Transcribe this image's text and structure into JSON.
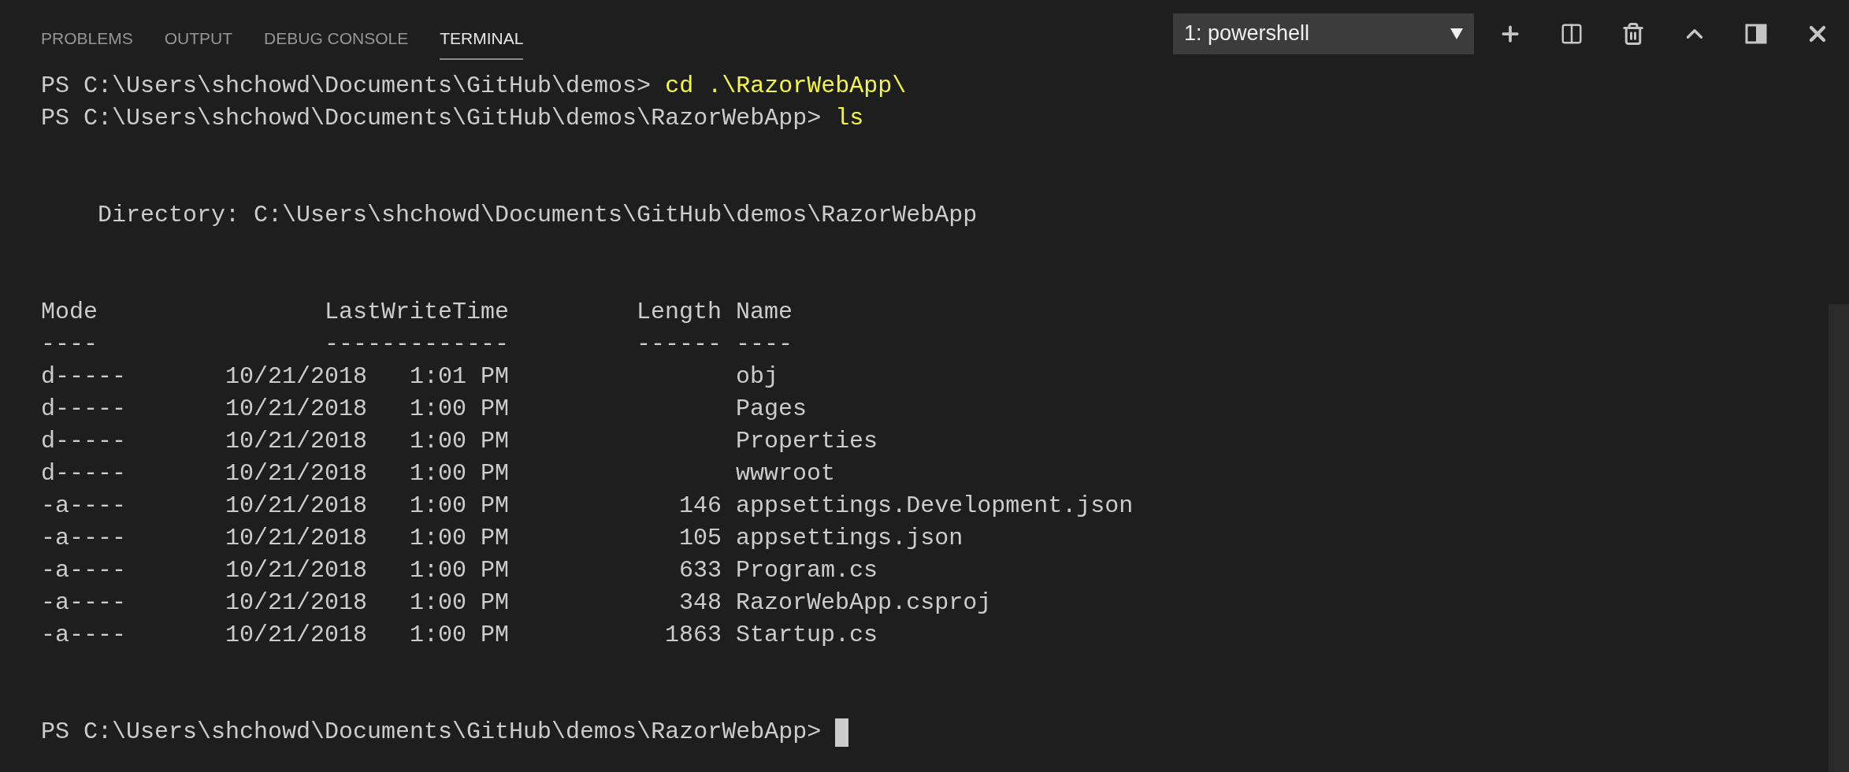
{
  "tabs": [
    {
      "label": "PROBLEMS",
      "selected": false
    },
    {
      "label": "OUTPUT",
      "selected": false
    },
    {
      "label": "DEBUG CONSOLE",
      "selected": false
    },
    {
      "label": "TERMINAL",
      "selected": true
    }
  ],
  "terminal_select": {
    "value": "1: powershell"
  },
  "commands": [
    {
      "prompt": "PS C:\\Users\\shchowd\\Documents\\GitHub\\demos>",
      "command": "cd .\\RazorWebApp\\"
    },
    {
      "prompt": "PS C:\\Users\\shchowd\\Documents\\GitHub\\demos\\RazorWebApp>",
      "command": "ls"
    }
  ],
  "directory_line": "Directory: C:\\Users\\shchowd\\Documents\\GitHub\\demos\\RazorWebApp",
  "listing": {
    "columns": [
      "Mode",
      "LastWriteTime",
      "Length",
      "Name"
    ],
    "separators": [
      "----",
      "-------------",
      "------",
      "----"
    ],
    "rows": [
      {
        "mode": "d-----",
        "date": "10/21/2018",
        "time": "1:01 PM",
        "name": "obj"
      },
      {
        "mode": "d-----",
        "date": "10/21/2018",
        "time": "1:00 PM",
        "name": "Pages"
      },
      {
        "mode": "d-----",
        "date": "10/21/2018",
        "time": "1:00 PM",
        "name": "Properties"
      },
      {
        "mode": "d-----",
        "date": "10/21/2018",
        "time": "1:00 PM",
        "name": "wwwroot"
      },
      {
        "mode": "-a----",
        "date": "10/21/2018",
        "time": "1:00 PM",
        "length": "146",
        "name": "appsettings.Development.json"
      },
      {
        "mode": "-a----",
        "date": "10/21/2018",
        "time": "1:00 PM",
        "length": "105",
        "name": "appsettings.json"
      },
      {
        "mode": "-a----",
        "date": "10/21/2018",
        "time": "1:00 PM",
        "length": "633",
        "name": "Program.cs"
      },
      {
        "mode": "-a----",
        "date": "10/21/2018",
        "time": "1:00 PM",
        "length": "348",
        "name": "RazorWebApp.csproj"
      },
      {
        "mode": "-a----",
        "date": "10/21/2018",
        "time": "1:00 PM",
        "length": "1863",
        "name": "Startup.cs"
      }
    ]
  },
  "final_prompt": "PS C:\\Users\\shchowd\\Documents\\GitHub\\demos\\RazorWebApp>"
}
